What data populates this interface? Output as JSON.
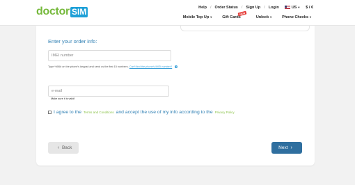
{
  "header": {
    "logo_part1": "doctor",
    "logo_part2": "SIM",
    "top_links": [
      "Help",
      "Order Status",
      "Sign Up",
      "Login"
    ],
    "language": "US",
    "currency": "$ / €",
    "main_nav": [
      "Mobile Top Up",
      "Gift Cards",
      "Unlock",
      "Phone Checks"
    ],
    "new_badge": "NEW"
  },
  "form": {
    "section_title": "Enter your order info:",
    "imei_placeholder": "IMEI number",
    "imei_hint": "Type *#06# on the phone's keypad and send us the first 15 numbers.",
    "imei_hint_link": "Can't find the phone's IMEI number?",
    "email_placeholder": "e-mail",
    "email_valid": "Make sure it is valid!",
    "terms_prefix": "I agree to the",
    "terms_link": "Terms and Conditions",
    "terms_middle": "and accept the use of my info according to the",
    "privacy_link": "Privacy Policy"
  },
  "buttons": {
    "back": "Back",
    "next": "Next"
  },
  "colors": {
    "logo_green": "#76b93c",
    "logo_blue": "#1ea0d7",
    "next_button": "#2f6f9f",
    "title_blue": "#2e7fb3"
  }
}
